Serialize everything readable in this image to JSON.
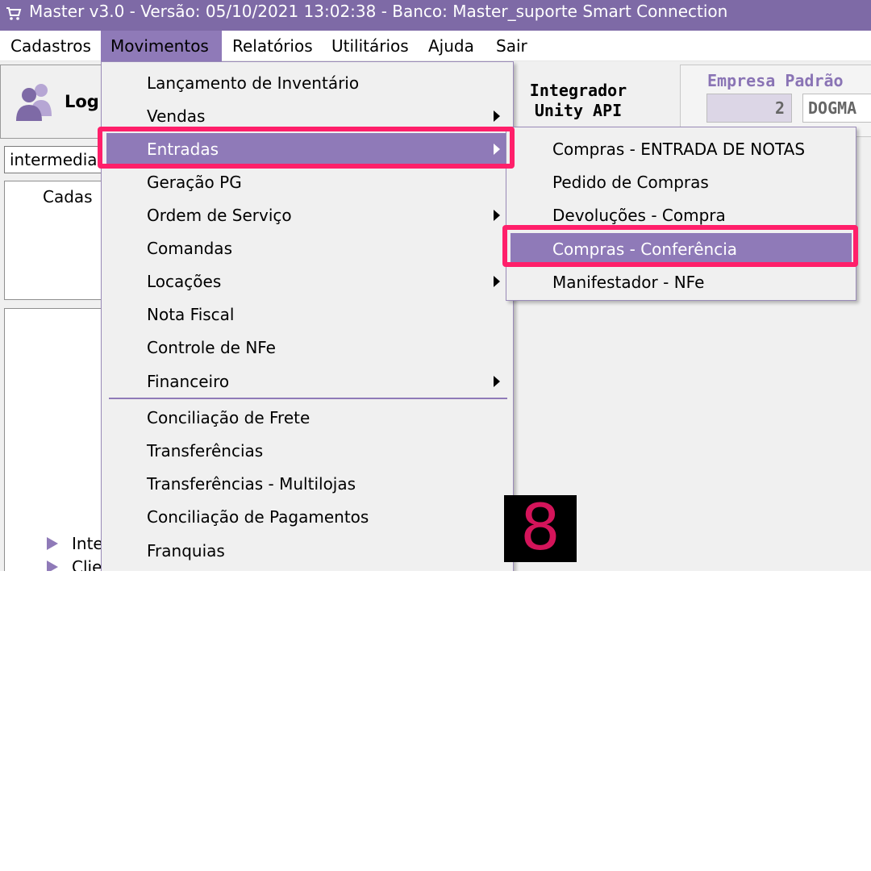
{
  "window": {
    "title": "Master  v3.0 -  Versão: 05/10/2021 13:02:38 - Banco: Master_suporte Smart Connection",
    "icon": "cart-icon"
  },
  "menubar": {
    "items": [
      {
        "label": "Cadastros"
      },
      {
        "label": "Movimentos"
      },
      {
        "label": "Relatórios"
      },
      {
        "label": "Utilitários"
      },
      {
        "label": "Ajuda"
      },
      {
        "label": "Sair"
      }
    ],
    "active": "Movimentos"
  },
  "background": {
    "login_label": "Log",
    "integrador_line1": "Integrador",
    "integrador_line2": "Unity API",
    "empresa_title": "Empresa Padrão",
    "empresa_code": "2",
    "empresa_name": "DOGMA",
    "search_value": "intermedia",
    "tree_label": "Cadas",
    "tree_items": [
      "Inte",
      "Clie"
    ]
  },
  "movimentos_menu": {
    "items": [
      {
        "label": "Lançamento de Inventário",
        "submenu": false
      },
      {
        "label": "Vendas",
        "submenu": true
      },
      {
        "label": "Entradas",
        "submenu": true,
        "highlighted": true
      },
      {
        "label": "Geração PG",
        "submenu": false
      },
      {
        "label": "Ordem de Serviço",
        "submenu": true
      },
      {
        "label": "Comandas",
        "submenu": false
      },
      {
        "label": "Locações",
        "submenu": true
      },
      {
        "label": "Nota Fiscal",
        "submenu": false
      },
      {
        "label": "Controle de NFe",
        "submenu": false
      },
      {
        "label": "Financeiro",
        "submenu": true
      },
      {
        "label": "Conciliação de Frete",
        "submenu": false
      },
      {
        "label": "Transferências",
        "submenu": false
      },
      {
        "label": "Transferências - Multilojas",
        "submenu": false
      },
      {
        "label": "Conciliação de Pagamentos",
        "submenu": false
      },
      {
        "label": "Franquias",
        "submenu": false
      }
    ]
  },
  "entradas_submenu": {
    "items": [
      {
        "label": "Compras - ENTRADA DE NOTAS"
      },
      {
        "label": "Pedido de Compras"
      },
      {
        "label": "Devoluções - Compra"
      },
      {
        "label": "Compras - Conferência",
        "highlighted": true
      },
      {
        "label": "Manifestador - NFe"
      }
    ]
  },
  "step_badge": "8",
  "colors": {
    "titlebar": "#7e6aa6",
    "highlight": "#8f7ab8",
    "annotation": "#ff1f6a",
    "badge_text": "#d4145a"
  }
}
